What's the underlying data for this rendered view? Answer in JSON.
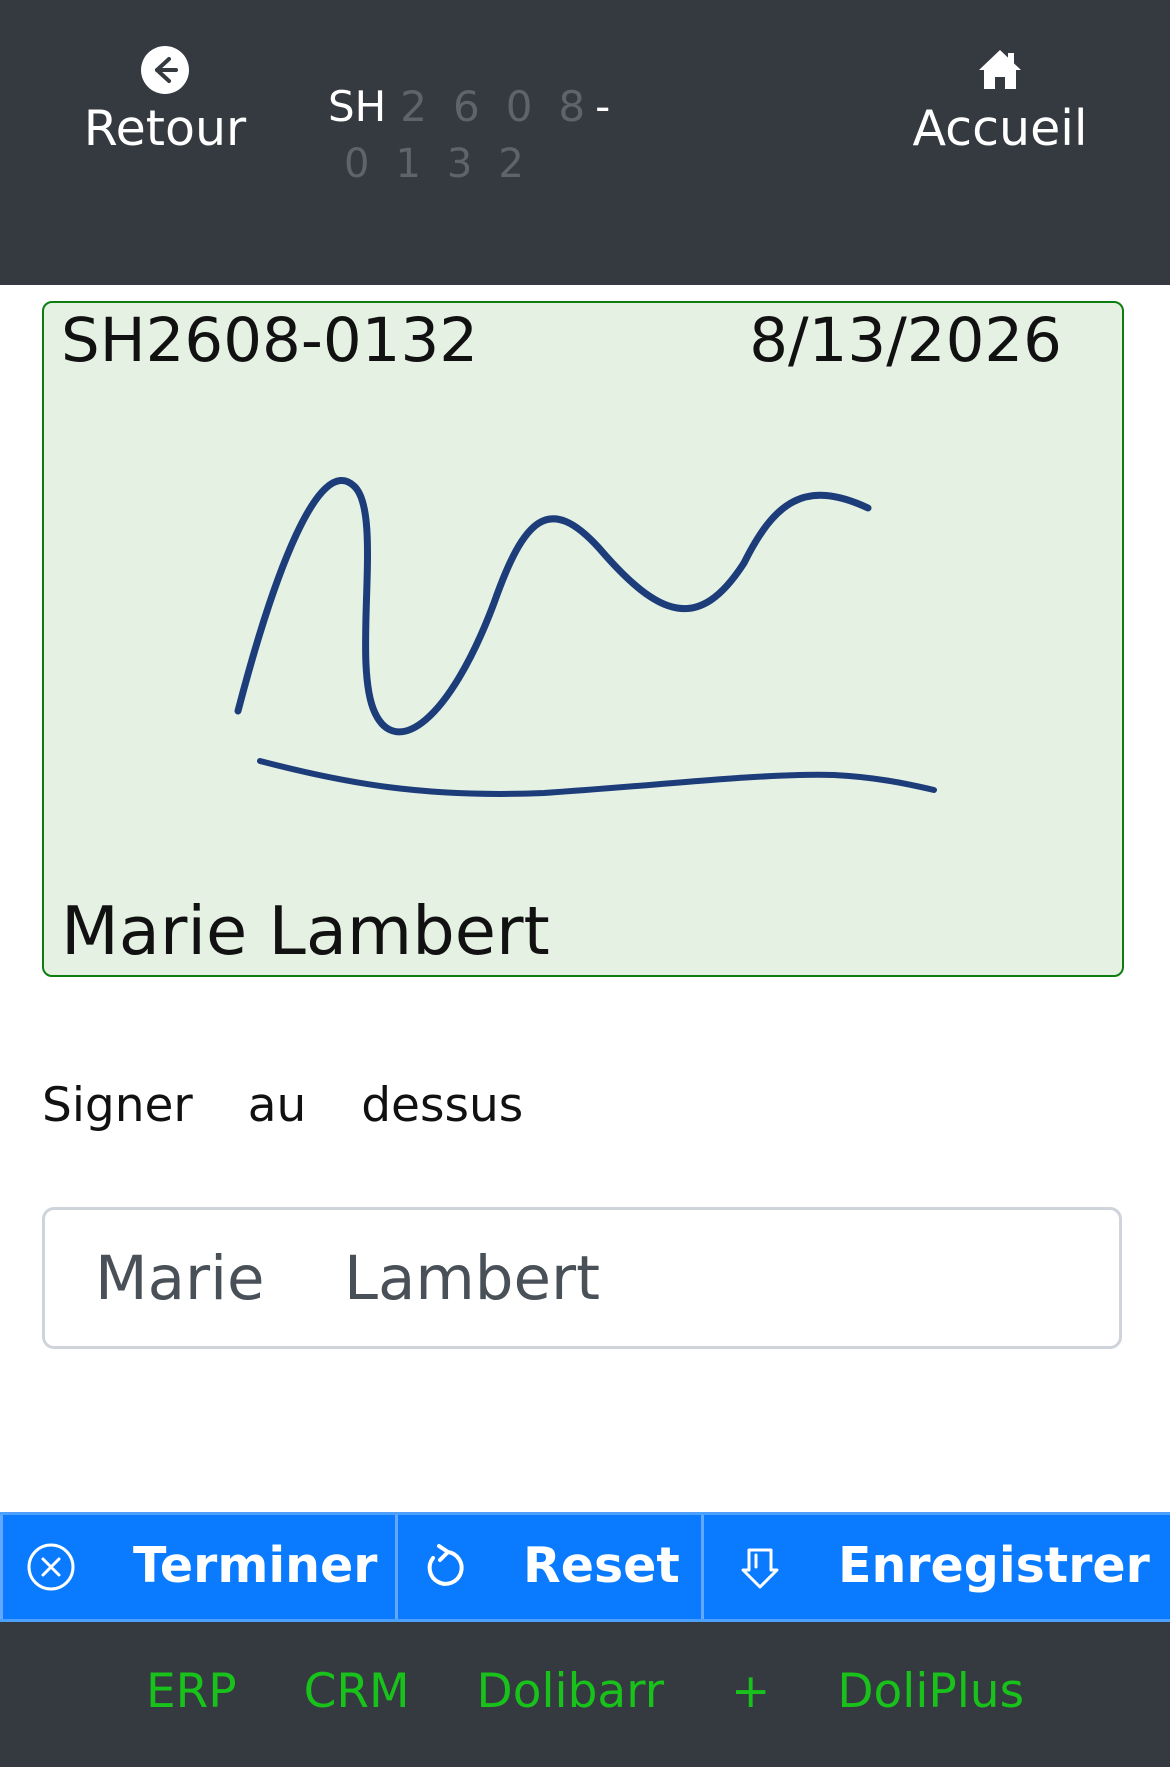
{
  "header": {
    "back_label": "Retour",
    "home_label": "Accueil",
    "ref_prefix": "SH",
    "ref_digits_line1": "2608",
    "ref_dash": "-",
    "ref_digits_line2": "0132"
  },
  "signature_pad": {
    "reference": "SH2608-0132",
    "date": "8/13/2026",
    "signer_name": "Marie Lambert",
    "stroke_color": "#1d3d7a"
  },
  "form": {
    "hint": "Signer au dessus",
    "name_value": "Marie Lambert"
  },
  "actions": {
    "finish_label": "Terminer",
    "reset_label": "Reset",
    "save_label": "Enregistrer"
  },
  "footer": {
    "text": "ERP CRM Dolibarr + DoliPlus"
  },
  "colors": {
    "header_bg": "#343a40",
    "pad_bg": "#e4f1e3",
    "pad_border": "#0e7d10",
    "action_bg": "#0a7bff",
    "footer_text": "#18c21a"
  },
  "icons": {
    "back": "arrow-left-circle-icon",
    "home": "home-icon",
    "finish": "x-circle-icon",
    "reset": "rotate-icon",
    "save": "download-icon"
  }
}
